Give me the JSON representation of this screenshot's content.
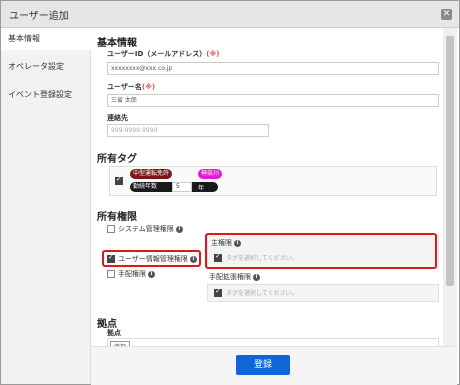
{
  "dialog": {
    "title": "ユーザー追加"
  },
  "sidebar": {
    "items": [
      {
        "label": "基本情報"
      },
      {
        "label": "オペレータ設定"
      },
      {
        "label": "イベント登録設定"
      }
    ]
  },
  "basic": {
    "heading": "基本情報",
    "userid_label": "ユーザーID（メールアドレス）",
    "userid_req": "(※)",
    "userid_value": "xxxxxxxx@xxx.co.jp",
    "username_label": "ユーザー名",
    "username_req": "(※)",
    "username_value": "三省 太郎",
    "contact_label": "連絡先",
    "contact_placeholder": "999-9999-9999"
  },
  "tags": {
    "heading": "所有タグ",
    "items": [
      {
        "label": "中型運転免許",
        "color": "#7b1717"
      },
      {
        "label": "神奈川",
        "color": "#e21ad5"
      }
    ],
    "years_label": "勤続年数",
    "years_value": "5",
    "years_unit": "年"
  },
  "permissions": {
    "heading": "所有権限",
    "system_admin": "システム管理権限",
    "user_info_admin": "ユーザー情報管理権限",
    "arrangement": "手配権限",
    "main_label": "主権限",
    "main_placeholder": "タグを選択してください。",
    "ext_label": "手配拡張権限",
    "ext_placeholder": "タグを選択してください。"
  },
  "base": {
    "heading": "拠点",
    "label": "拠点",
    "add_label": "追加"
  },
  "footer": {
    "register_label": "登録"
  },
  "colors": {
    "primary": "#0e66d8",
    "highlight": "#d71a1a",
    "required": "#d9534f"
  }
}
